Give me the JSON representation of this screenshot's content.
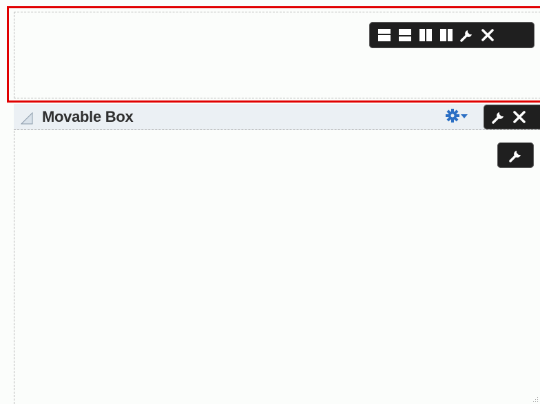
{
  "top_container": {
    "selected": true,
    "toolbar": {
      "buttons": [
        {
          "icon": "layout-stacked-top-icon"
        },
        {
          "icon": "layout-stacked-bottom-icon"
        },
        {
          "icon": "layout-columns-icon"
        },
        {
          "icon": "layout-column-right-icon"
        },
        {
          "icon": "wrench-icon"
        },
        {
          "icon": "close-icon"
        }
      ]
    }
  },
  "movable_box": {
    "title": "Movable Box",
    "header_icons": {
      "collapse": "collapse-triangle-icon",
      "menu": "gear-icon",
      "menu_caret": "chevron-down-icon"
    },
    "toolbar": {
      "buttons": [
        {
          "icon": "wrench-icon"
        },
        {
          "icon": "close-icon"
        }
      ]
    },
    "content_toolbar": {
      "buttons": [
        {
          "icon": "wrench-icon"
        }
      ]
    }
  },
  "colors": {
    "selection_border": "#e00000",
    "toolbar_bg": "#1f1f1f",
    "header_bg": "#ebf0f4",
    "gear_blue": "#2b6fc4"
  }
}
